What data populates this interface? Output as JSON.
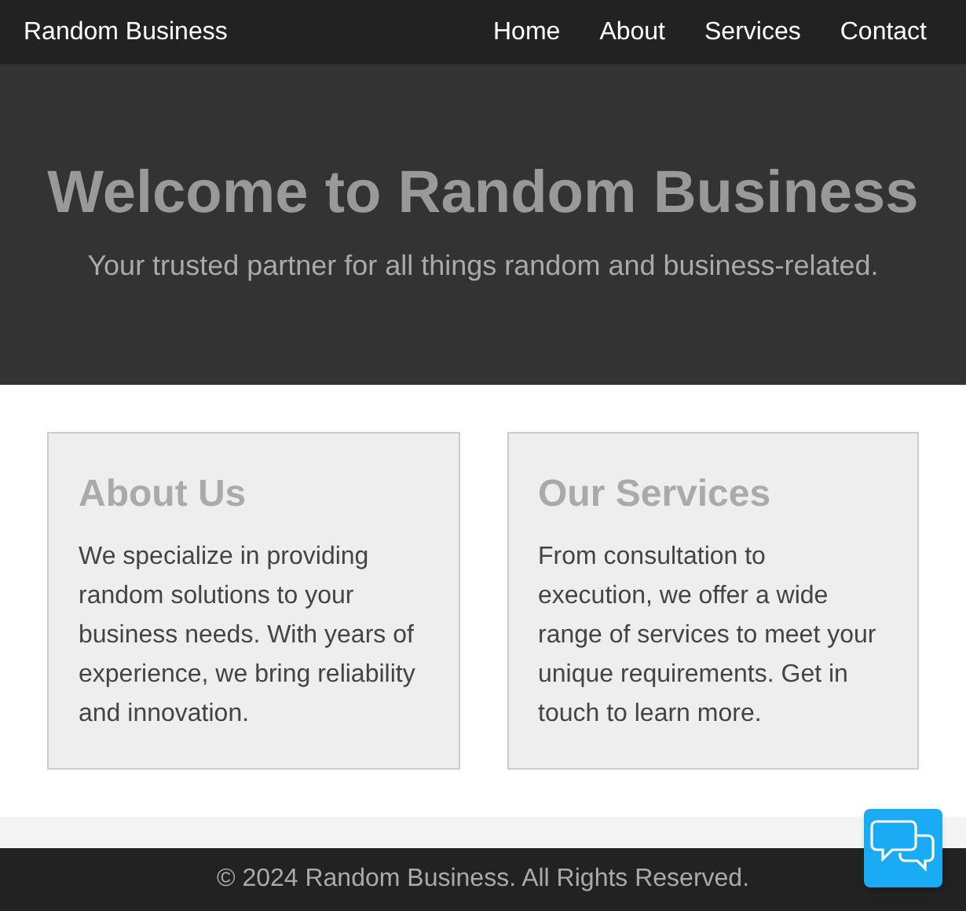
{
  "nav": {
    "brand": "Random Business",
    "links": [
      "Home",
      "About",
      "Services",
      "Contact"
    ]
  },
  "hero": {
    "title": "Welcome to Random Business",
    "subtitle": "Your trusted partner for all things random and business-related."
  },
  "cards": [
    {
      "title": "About Us",
      "text": "We specialize in providing random solutions to your business needs. With years of experience, we bring reliability and innovation."
    },
    {
      "title": "Our Services",
      "text": "From consultation to execution, we offer a wide range of services to meet your unique requirements. Get in touch to learn more."
    }
  ],
  "footer": "© 2024 Random Business. All Rights Reserved."
}
